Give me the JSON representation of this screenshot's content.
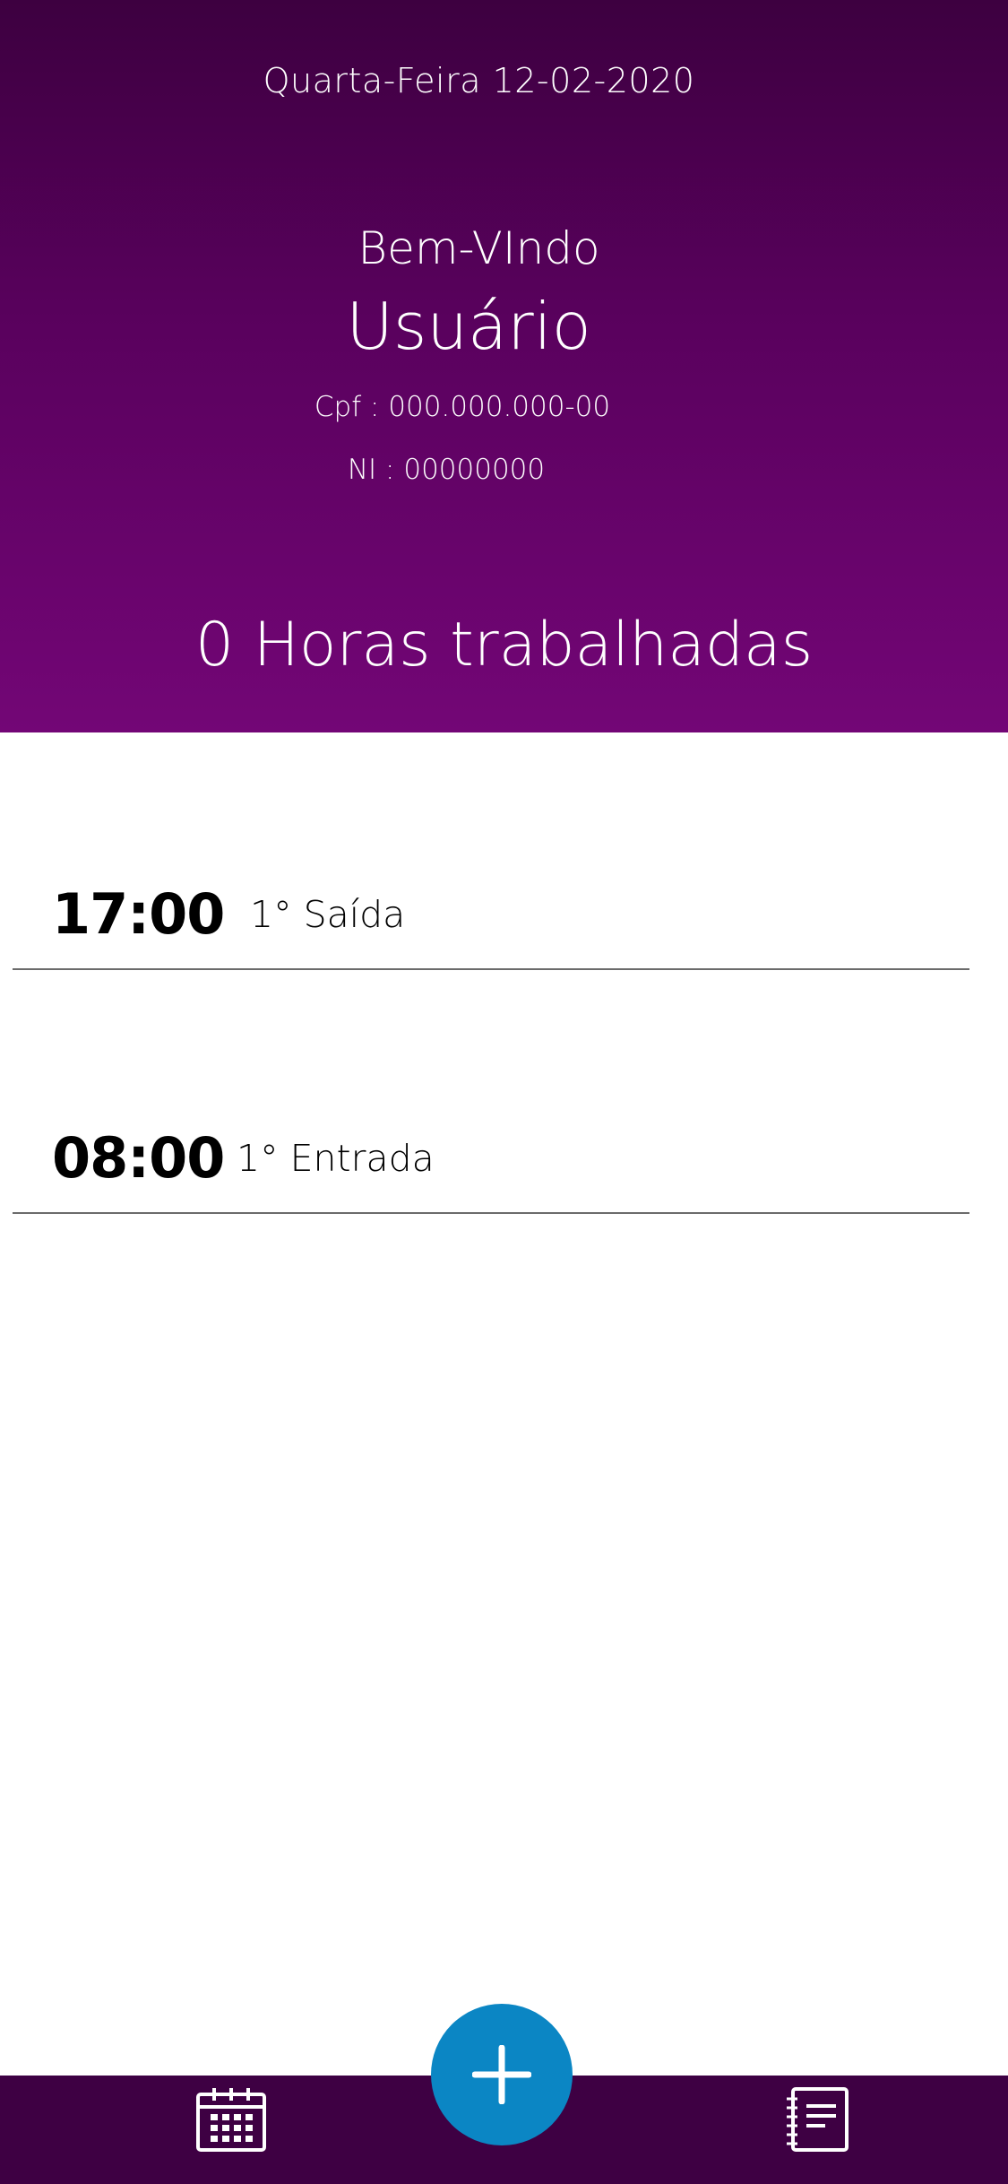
{
  "header": {
    "date": "Quarta-Feira 12-02-2020",
    "welcome": "Bem-VIndo",
    "username": "Usuário",
    "cpf": "Cpf : 000.000.000-00",
    "ni": "NI : 00000000",
    "hours_worked": "0 Horas trabalhadas",
    "gradient_top": "#3d0040",
    "gradient_bottom": "#730676"
  },
  "records": [
    {
      "time": "17:00",
      "label": "1° Saída"
    },
    {
      "time": "08:00",
      "label": "1° Entrada"
    }
  ],
  "bottom_nav": {
    "background": "#3e0043",
    "left_icon": "calendar-icon",
    "center_button_icon": "plus-icon",
    "center_button_color": "#0b86c4",
    "right_icon": "notes-icon"
  }
}
